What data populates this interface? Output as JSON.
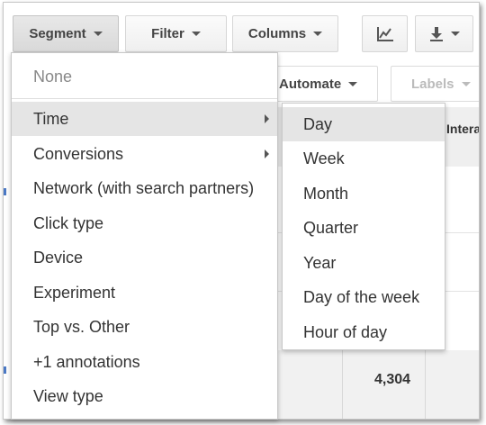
{
  "toolbar": {
    "segment_label": "Segment",
    "filter_label": "Filter",
    "columns_label": "Columns",
    "chart_icon": "line-chart-icon",
    "download_icon": "download-icon"
  },
  "background": {
    "automate_label": "Automate",
    "labels_label": "Labels",
    "column_header_partial": "Intera",
    "total_value": "4,304"
  },
  "segment_menu": {
    "items": [
      {
        "label": "None"
      },
      {
        "label": "Time",
        "has_submenu": true
      },
      {
        "label": "Conversions",
        "has_submenu": true
      },
      {
        "label": "Network (with search partners)"
      },
      {
        "label": "Click type"
      },
      {
        "label": "Device"
      },
      {
        "label": "Experiment"
      },
      {
        "label": "Top vs. Other"
      },
      {
        "label": "+1 annotations"
      },
      {
        "label": "View type"
      }
    ]
  },
  "time_submenu": {
    "items": [
      {
        "label": "Day"
      },
      {
        "label": "Week"
      },
      {
        "label": "Month"
      },
      {
        "label": "Quarter"
      },
      {
        "label": "Year"
      },
      {
        "label": "Day of the week"
      },
      {
        "label": "Hour of day"
      }
    ]
  }
}
